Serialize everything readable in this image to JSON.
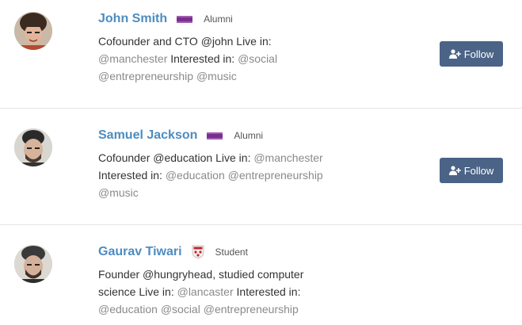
{
  "users": [
    {
      "name": "John Smith",
      "badge_icon": "university-logo-purple",
      "role": "Alumni",
      "bio_prefix": "Cofounder and CTO @john",
      "live_label": "Live in:",
      "location": "@manchester",
      "interest_label": "Interested in:",
      "interests": [
        "@social",
        "@entrepreneurship",
        "@music"
      ],
      "follow_label": "Follow"
    },
    {
      "name": "Samuel Jackson",
      "badge_icon": "university-logo-purple",
      "role": "Alumni",
      "bio_prefix": "Cofounder @education",
      "live_label": "Live in:",
      "location": "@manchester",
      "interest_label": "Interested in:",
      "interests": [
        "@education",
        "@entrepreneurship",
        "@music"
      ],
      "follow_label": "Follow"
    },
    {
      "name": "Gaurav Tiwari",
      "badge_icon": "university-crest",
      "role": "Student",
      "bio_prefix": "Founder @hungryhead, studied computer science",
      "live_label": "Live in:",
      "location": "@lancaster",
      "interest_label": "Interested in:",
      "interests": [
        "@education",
        "@social",
        "@entrepreneurship"
      ]
    }
  ],
  "colors": {
    "name": "#4d8cc0",
    "button": "#4a6386",
    "tag": "#8a8a8a"
  }
}
